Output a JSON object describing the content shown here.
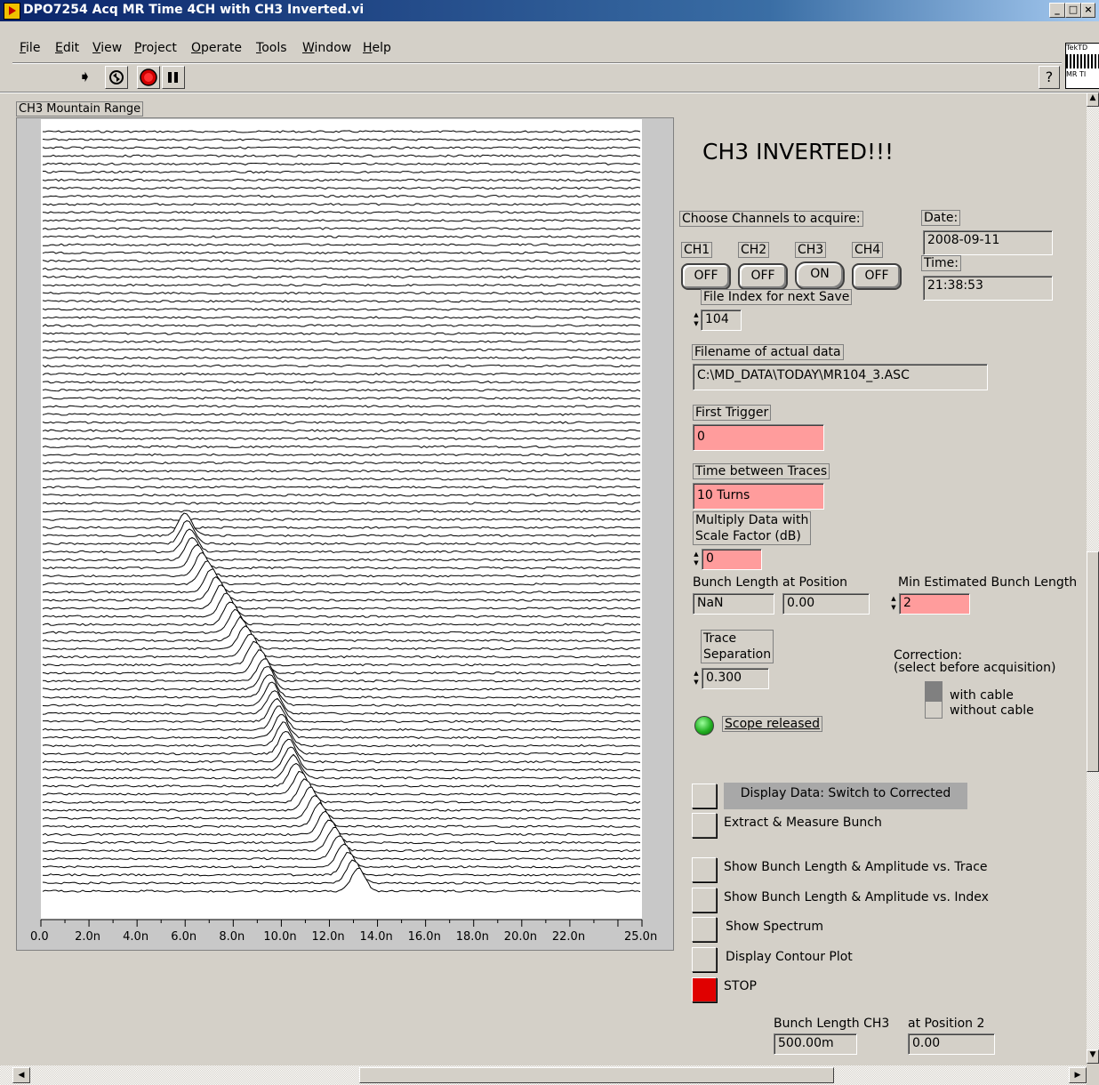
{
  "window": {
    "title": "DPO7254 Acq MR Time 4CH with CH3 Inverted.vi",
    "controls": [
      "_",
      "□",
      "×"
    ]
  },
  "menu": [
    {
      "underline": "F",
      "rest": "ile"
    },
    {
      "underline": "E",
      "rest": "dit"
    },
    {
      "underline": "V",
      "rest": "iew"
    },
    {
      "underline": "P",
      "rest": "roject"
    },
    {
      "underline": "O",
      "rest": "perate"
    },
    {
      "underline": "T",
      "rest": "ools"
    },
    {
      "underline": "W",
      "rest": "indow"
    },
    {
      "underline": "H",
      "rest": "elp"
    }
  ],
  "toolbar": {
    "icons": [
      "run-arrow-icon",
      "run-continuously-icon",
      "abort-icon",
      "pause-icon"
    ],
    "help": "?",
    "connector_pane": [
      "TekTD",
      "MR TI"
    ]
  },
  "graph": {
    "label": "CH3 Mountain Range",
    "ticks": [
      "0.0",
      "2.0n",
      "4.0n",
      "6.0n",
      "8.0n",
      "10.0n",
      "12.0n",
      "14.0n",
      "16.0n",
      "18.0n",
      "20.0n",
      "22.0n",
      "25.0n"
    ]
  },
  "chart_data": {
    "type": "line",
    "title": "CH3 Mountain Range",
    "xlabel": "",
    "ylabel": "",
    "xlim": [
      0,
      2.5e-08
    ],
    "x_tick_labels": [
      "0.0",
      "2.0n",
      "4.0n",
      "6.0n",
      "8.0n",
      "10.0n",
      "12.0n",
      "14.0n",
      "16.0n",
      "18.0n",
      "20.0n",
      "22.0n",
      "25.0n"
    ],
    "trace_count": 95,
    "trace_separation": 0.3,
    "peak_positions_ns_from_trace_36": [
      6.0,
      6.1,
      6.2,
      6.3,
      6.5,
      6.7,
      6.9,
      7.1,
      7.3,
      7.5,
      7.7,
      7.9,
      8.1,
      8.3,
      8.5,
      8.7,
      8.9,
      9.1,
      9.3,
      9.4,
      9.5,
      9.6,
      9.7,
      9.8,
      9.9,
      10.0,
      10.1,
      10.2,
      10.3,
      10.4,
      10.5,
      10.6,
      10.8,
      11.0,
      11.2,
      11.4,
      11.6,
      11.8,
      12.0,
      12.2,
      12.4,
      12.6,
      12.8,
      13.0,
      13.2
    ],
    "grid": false
  },
  "panel": {
    "heading": "CH3 INVERTED!!!",
    "choose_label": "Choose Channels to acquire:",
    "channels": [
      {
        "name": "CH1",
        "state": "OFF"
      },
      {
        "name": "CH2",
        "state": "OFF"
      },
      {
        "name": "CH3",
        "state": "ON"
      },
      {
        "name": "CH4",
        "state": "OFF"
      }
    ],
    "date_label": "Date:",
    "date_value": "2008-09-11",
    "time_label": "Time:",
    "time_value": "21:38:53",
    "file_index_label": "File Index for next Save",
    "file_index_value": "104",
    "filename_label": "Filename of actual data",
    "filename_value": "C:\\MD_DATA\\TODAY\\MR104_3.ASC",
    "first_trigger_label": "First Trigger",
    "first_trigger_value": "0",
    "time_between_label": "Time between Traces",
    "time_between_value": "10 Turns",
    "multiply_label_1": "Multiply Data with",
    "multiply_label_2": "Scale Factor (dB)",
    "multiply_value": "0",
    "bunch_length_label": "Bunch Length",
    "bunch_length_value": "NaN",
    "at_position_label": "at Position",
    "at_position_value": "0.00",
    "min_est_label": "Min Estimated Bunch Length",
    "min_est_value": "2",
    "trace_sep_label_1": "Trace",
    "trace_sep_label_2": "Separation",
    "trace_sep_value": "0.300",
    "correction_label_1": "Correction:",
    "correction_label_2": "(select before acquisition)",
    "with_cable": "with cable",
    "without_cable": "without cable",
    "scope_status": "Scope released",
    "buttons": {
      "display_data": "Display Data: Switch to Corrected",
      "extract": "Extract & Measure Bunch",
      "show_vs_trace": "Show Bunch Length & Amplitude vs. Trace",
      "show_vs_index": "Show Bunch Length & Amplitude vs. Index",
      "show_spectrum": "Show Spectrum",
      "contour": "Display Contour Plot",
      "stop": "STOP"
    },
    "bunch_length_ch3_label": "Bunch Length CH3",
    "bunch_length_ch3_value": "500.00m",
    "at_position2_label": "at Position 2",
    "at_position2_value": "0.00"
  },
  "colors": {
    "background": "#d4d0c8",
    "pink_field": "#ff9c9c",
    "led_green": "#22b022",
    "stop_red": "#e00000",
    "title_blue": "#0a246a"
  }
}
